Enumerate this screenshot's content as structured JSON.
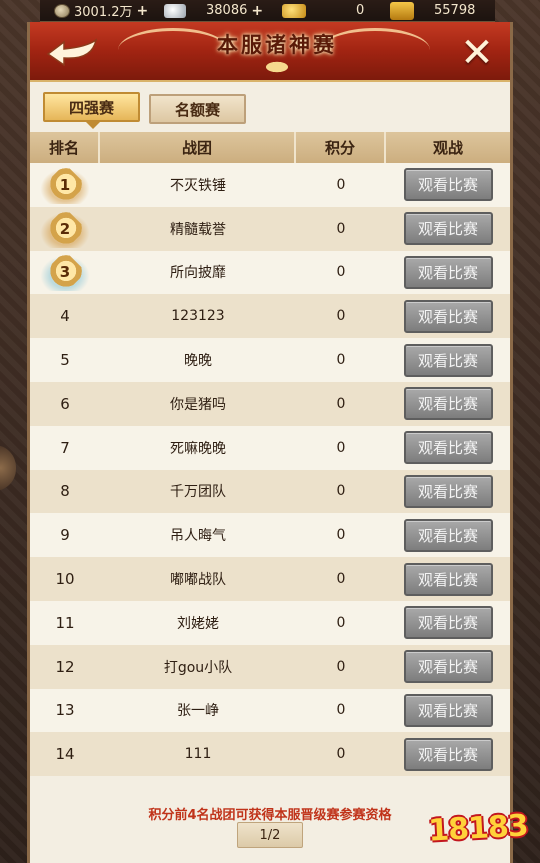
{
  "resources": [
    {
      "icon": "copper-coin-icon",
      "value": "3001.2万",
      "has_plus": true
    },
    {
      "icon": "silver-ingot-icon",
      "value": "38086",
      "has_plus": true
    },
    {
      "icon": "gold-ingot-icon",
      "value": "0",
      "has_plus": false
    },
    {
      "icon": "treasure-bag-icon",
      "value": "55798",
      "has_plus": false
    }
  ],
  "header": {
    "title": "本服诸神赛",
    "close_label": "✕"
  },
  "tabs": [
    {
      "label": "四强赛",
      "active": true
    },
    {
      "label": "名额赛",
      "active": false
    }
  ],
  "table": {
    "columns": [
      "排名",
      "战团",
      "积分",
      "观战"
    ],
    "rows": [
      {
        "rank": "1",
        "team": "不灭铁锤",
        "score": "0",
        "action": "观看比赛"
      },
      {
        "rank": "2",
        "team": "精髓载誉",
        "score": "0",
        "action": "观看比赛"
      },
      {
        "rank": "3",
        "team": "所向披靡",
        "score": "0",
        "action": "观看比赛"
      },
      {
        "rank": "4",
        "team": "123123",
        "score": "0",
        "action": "观看比赛"
      },
      {
        "rank": "5",
        "team": "晚晚",
        "score": "0",
        "action": "观看比赛"
      },
      {
        "rank": "6",
        "team": "你是猪吗",
        "score": "0",
        "action": "观看比赛"
      },
      {
        "rank": "7",
        "team": "死嘛晚晚",
        "score": "0",
        "action": "观看比赛"
      },
      {
        "rank": "8",
        "team": "千万团队",
        "score": "0",
        "action": "观看比赛"
      },
      {
        "rank": "9",
        "team": "吊人晦气",
        "score": "0",
        "action": "观看比赛"
      },
      {
        "rank": "10",
        "team": "嘟嘟战队",
        "score": "0",
        "action": "观看比赛"
      },
      {
        "rank": "11",
        "team": "刘姥姥",
        "score": "0",
        "action": "观看比赛"
      },
      {
        "rank": "12",
        "team": "打gou小队",
        "score": "0",
        "action": "观看比赛"
      },
      {
        "rank": "13",
        "team": "张一峥",
        "score": "0",
        "action": "观看比赛"
      },
      {
        "rank": "14",
        "team": "111",
        "score": "0",
        "action": "观看比赛"
      }
    ]
  },
  "footer": {
    "note": "积分前4名战团可获得本服晋级赛参赛资格",
    "page": "1/2"
  },
  "watermark": "18183",
  "colors": {
    "header_red": "#a12412",
    "accent_gold": "#e6b659",
    "note_red": "#c0331a",
    "button_gray": "#8f8f8f"
  }
}
